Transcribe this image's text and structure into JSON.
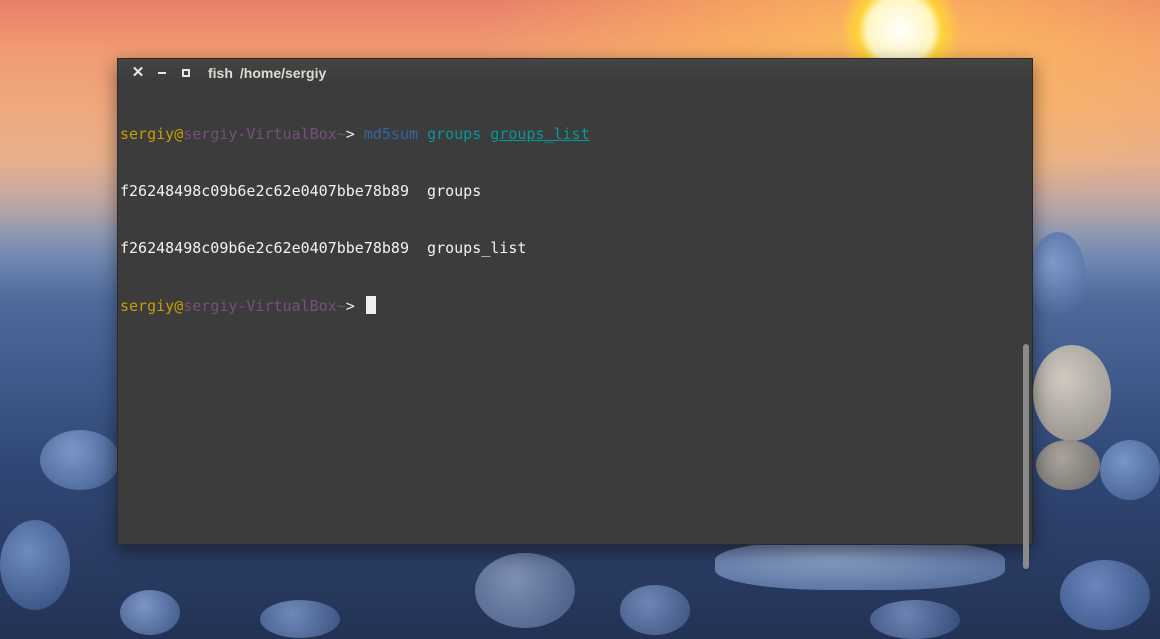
{
  "window": {
    "app": "fish",
    "path": "/home/sergiy"
  },
  "terminal": {
    "prompt": {
      "user": "sergiy",
      "at": "@",
      "host": "sergiy-VirtualBox",
      "tilde": "~",
      "arrow": ">"
    },
    "command": {
      "name": "md5sum",
      "arg1": "groups",
      "arg2": "groups_list"
    },
    "output": [
      {
        "hash": "f26248498c09b6e2c62e0407bbe78b89",
        "file": "groups"
      },
      {
        "hash": "f26248498c09b6e2c62e0407bbe78b89",
        "file": "groups_list"
      }
    ]
  },
  "icons": {
    "close": "close-icon",
    "minimize": "minimize-icon",
    "maximize": "maximize-icon"
  },
  "colors": {
    "terminal_bg": "#3c3c3c",
    "user": "#c4a000",
    "host": "#75507b",
    "command": "#3465a4",
    "argument": "#06989a"
  }
}
